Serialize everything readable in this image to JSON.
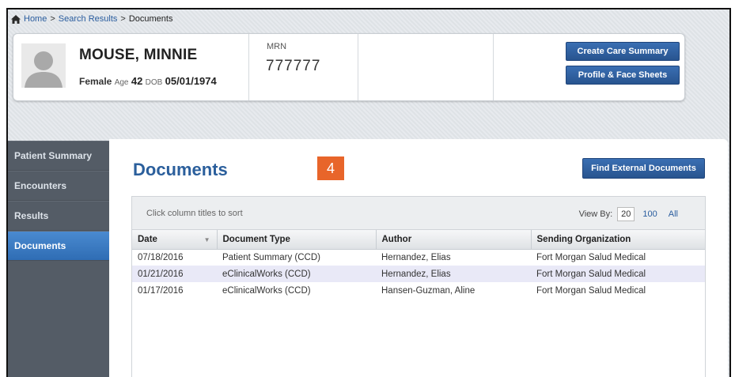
{
  "breadcrumb": {
    "home": "Home",
    "sep1": ">",
    "search_results": "Search Results",
    "sep2": ">",
    "current": "Documents"
  },
  "patient": {
    "name": "MOUSE, MINNIE",
    "gender": "Female",
    "age_label": "Age",
    "age": "42",
    "dob_label": "DOB",
    "dob": "05/01/1974",
    "mrn_label": "MRN",
    "mrn": "777777"
  },
  "header_buttons": {
    "create_care_summary": "Create Care Summary",
    "profile_face_sheets": "Profile & Face Sheets"
  },
  "sidebar": {
    "items": [
      {
        "label": "Patient Summary",
        "active": false
      },
      {
        "label": "Encounters",
        "active": false
      },
      {
        "label": "Results",
        "active": false
      },
      {
        "label": "Documents",
        "active": true
      }
    ]
  },
  "main": {
    "title": "Documents",
    "badge": "4",
    "find_external_button": "Find External Documents",
    "sort_hint": "Click column titles to sort",
    "view_by_label": "View By:",
    "view_by_options": [
      "20",
      "100",
      "All"
    ],
    "view_by_selected": "20"
  },
  "table": {
    "columns": [
      "Date",
      "Document Type",
      "Author",
      "Sending Organization"
    ],
    "rows": [
      [
        "07/18/2016",
        "Patient Summary (CCD)",
        "Hernandez, Elias",
        "Fort Morgan Salud Medical"
      ],
      [
        "01/21/2016",
        "eClinicalWorks (CCD)",
        "Hernandez, Elias",
        "Fort Morgan Salud Medical"
      ],
      [
        "01/17/2016",
        "eClinicalWorks (CCD)",
        "Hansen-Guzman, Aline",
        "Fort Morgan Salud Medical"
      ]
    ]
  },
  "colors": {
    "accent_blue": "#2b5f9c",
    "button_blue": "#3a6fb3",
    "sidebar_bg": "#545c66",
    "badge_orange": "#e8652a",
    "row_highlight": "#e9e9f7"
  },
  "icons": {
    "home": "home-icon",
    "avatar": "person-silhouette-icon",
    "sort": "sort-down-icon"
  }
}
